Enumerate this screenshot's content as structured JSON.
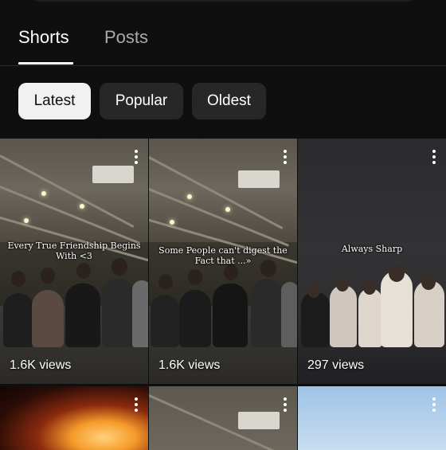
{
  "tabs": [
    {
      "label": "Shorts",
      "active": true
    },
    {
      "label": "Posts",
      "active": false
    }
  ],
  "filters": [
    {
      "label": "Latest",
      "selected": true
    },
    {
      "label": "Popular",
      "selected": false
    },
    {
      "label": "Oldest",
      "selected": false
    }
  ],
  "shorts": [
    {
      "views": "1.6K views",
      "caption": "Every True Friendship Begins With <3",
      "menu_icon": "more-vert-icon"
    },
    {
      "views": "1.6K views",
      "caption": "Some People can't digest the Fact that ...»",
      "menu_icon": "more-vert-icon"
    },
    {
      "views": "297 views",
      "caption": "Always Sharp",
      "menu_icon": "more-vert-icon"
    }
  ],
  "colors": {
    "background": "#0f0f0f",
    "chip": "#272727",
    "chip_selected": "#f1f1f1"
  }
}
